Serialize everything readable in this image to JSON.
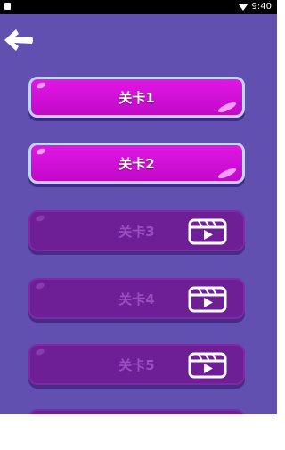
{
  "status_bar": {
    "time": "9:40",
    "icons": [
      "app-notification-icon",
      "wifi-icon"
    ]
  },
  "header": {
    "back_icon": "back-arrow-icon"
  },
  "levels": [
    {
      "label": "关卡1",
      "locked": false
    },
    {
      "label": "关卡2",
      "locked": false
    },
    {
      "label": "关卡3",
      "locked": true,
      "icon": "video-ad-icon"
    },
    {
      "label": "关卡4",
      "locked": true,
      "icon": "video-ad-icon"
    },
    {
      "label": "关卡5",
      "locked": true,
      "icon": "video-ad-icon"
    },
    {
      "label": "",
      "locked": true
    }
  ],
  "colors": {
    "background": "#6150b0",
    "button_unlocked": "#d512db",
    "button_locked": "#6e1f96",
    "button_border": "#c0d4ff"
  }
}
